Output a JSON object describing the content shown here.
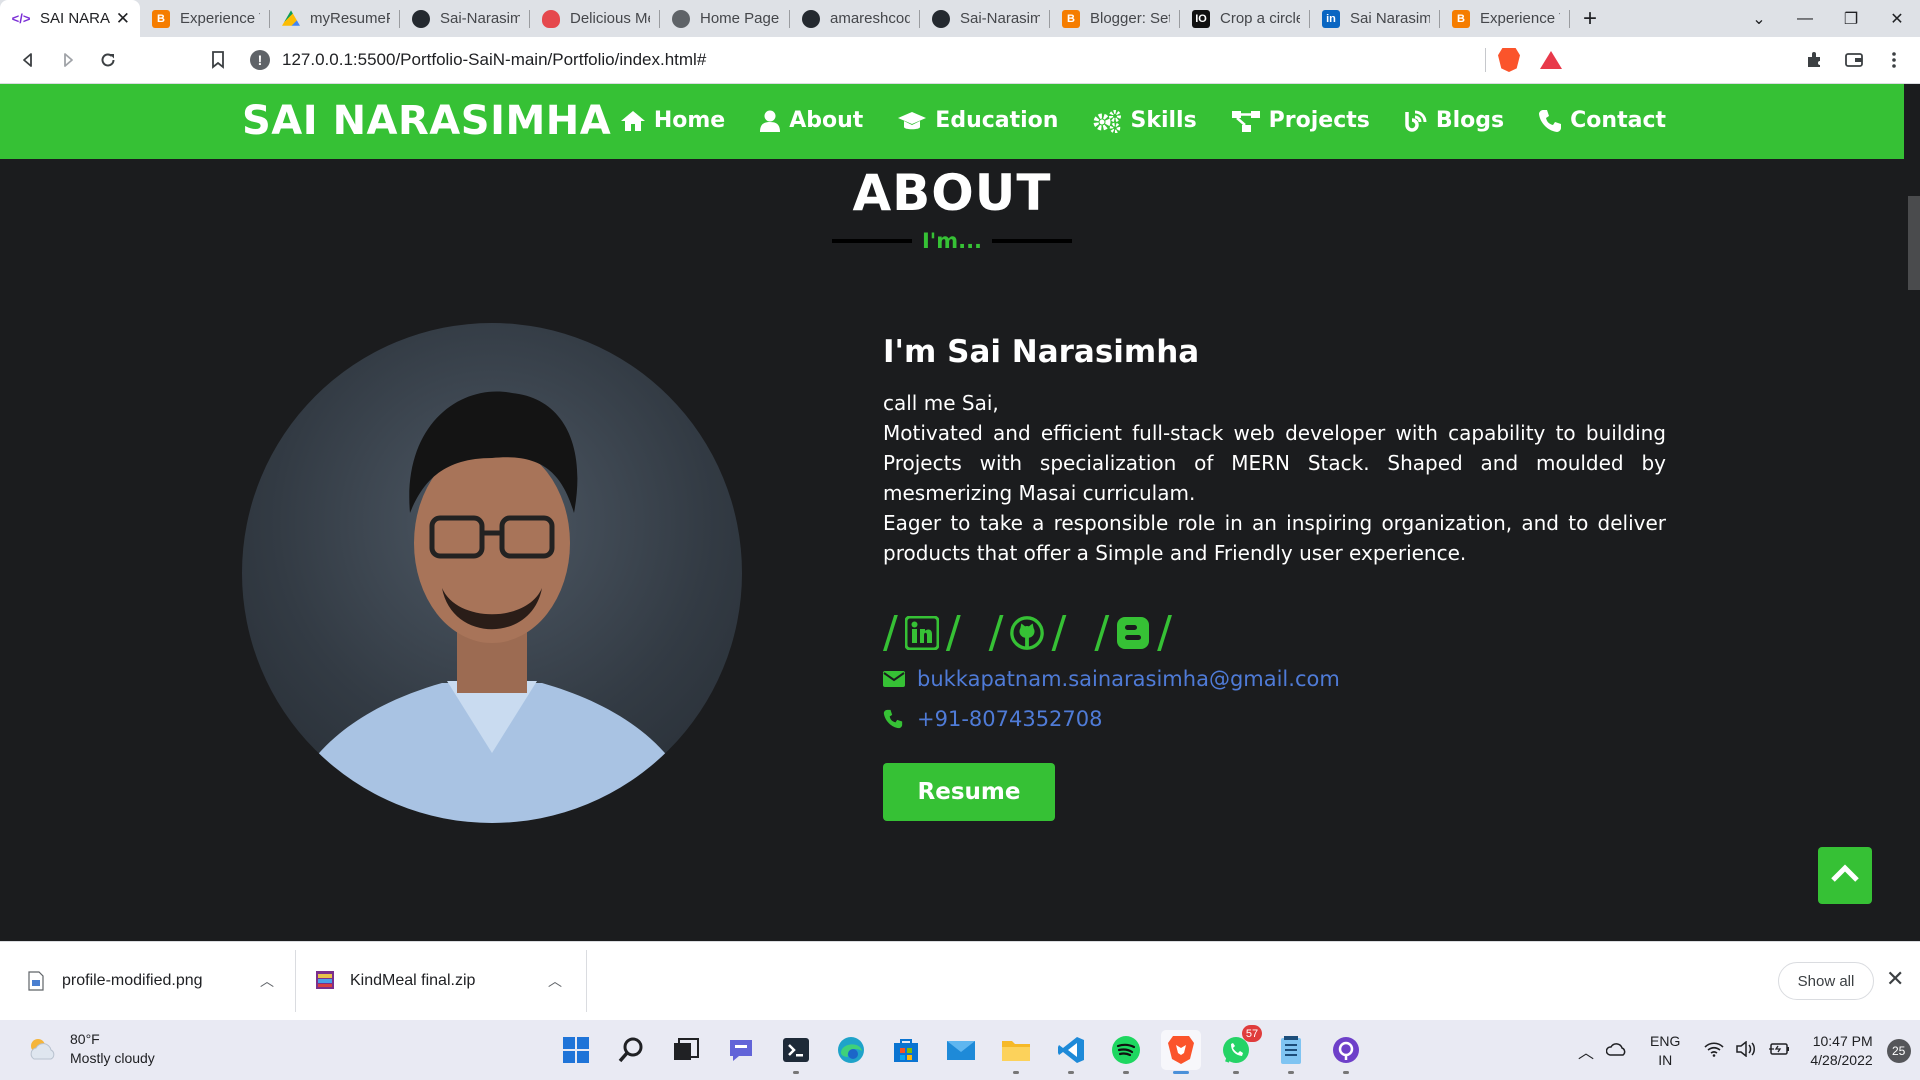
{
  "browser": {
    "tabs": [
      {
        "label": "SAI NARA",
        "icon": "code-icon",
        "active": true
      },
      {
        "label": "Experience Te",
        "icon": "blogger-icon"
      },
      {
        "label": "myResumeFi",
        "icon": "google-drive-icon"
      },
      {
        "label": "Sai-Narasimh",
        "icon": "github-icon"
      },
      {
        "label": "Delicious Me",
        "icon": "heart-icon"
      },
      {
        "label": "Home Page",
        "icon": "globe-icon"
      },
      {
        "label": "amareshcodi",
        "icon": "github-icon"
      },
      {
        "label": "Sai-Narasimh",
        "icon": "github-icon"
      },
      {
        "label": "Blogger: Sett",
        "icon": "blogger-icon"
      },
      {
        "label": "Crop a circle",
        "icon": "io-icon"
      },
      {
        "label": "Sai Narasimh",
        "icon": "linkedin-icon"
      },
      {
        "label": "Experience Te",
        "icon": "blogger-icon"
      }
    ],
    "new_tab": "+",
    "url": "127.0.0.1:5500/Portfolio-SaiN-main/Portfolio/index.html#"
  },
  "site": {
    "brand": "SAI NARASIMHA",
    "nav": [
      {
        "label": "Home",
        "icon": "home-icon"
      },
      {
        "label": "About",
        "icon": "user-icon"
      },
      {
        "label": "Education",
        "icon": "graduation-cap-icon"
      },
      {
        "label": "Skills",
        "icon": "gears-icon"
      },
      {
        "label": "Projects",
        "icon": "project-diagram-icon"
      },
      {
        "label": "Blogs",
        "icon": "blog-icon"
      },
      {
        "label": "Contact",
        "icon": "phone-icon"
      }
    ],
    "accent": "#36c135",
    "background": "#1b1c1e",
    "link_color": "#4f7bd7"
  },
  "about": {
    "heading": "ABOUT",
    "subtitle": "I'm...",
    "name_heading": "I'm Sai Narasimha",
    "greeting": "call me Sai,",
    "para1": "Motivated and efficient full-stack web developer with capability to building Projects with specialization of MERN Stack. Shaped and moulded by mesmerizing Masai curriculam.",
    "para2": "Eager to take a responsible role in an inspiring organization, and to deliver products that offer a Simple and Friendly user experience.",
    "social": [
      "linkedin-icon",
      "github-icon",
      "blogger-icon"
    ],
    "email": "bukkapatnam.sainarasimha@gmail.com",
    "phone": "+91-8074352708",
    "resume_label": "Resume"
  },
  "downloads": {
    "items": [
      {
        "name": "profile-modified.png"
      },
      {
        "name": "KindMeal final.zip"
      }
    ],
    "show_all": "Show all"
  },
  "taskbar": {
    "weather_temp": "80°F",
    "weather_desc": "Mostly cloudy",
    "whatsapp_badge": "57",
    "lang_line1": "ENG",
    "lang_line2": "IN",
    "time": "10:47 PM",
    "date": "4/28/2022",
    "notifications": "25"
  }
}
